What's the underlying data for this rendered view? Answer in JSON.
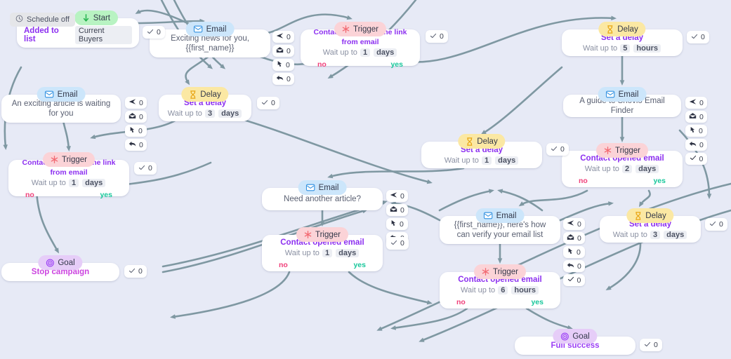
{
  "canvas": {
    "background": "#e7eaf6",
    "edge_color": "#7f98a2"
  },
  "schedule_chip": {
    "label": "Schedule off",
    "icon": "clock-icon"
  },
  "colors": {
    "email": "#cce6fb",
    "trigger": "#fbd3d7",
    "delay": "#fbe8a3",
    "goal": "#e6cdf8",
    "start": "#b8f3c2",
    "title_purple": "#8c2ff0",
    "title_magenta": "#cc44e0",
    "yes": "#18c79b",
    "no": "#f0407a"
  },
  "labels": {
    "wait_prefix": "Wait up to",
    "yes": "yes",
    "no": "no"
  },
  "stat_icons": [
    "sent-icon",
    "opened-icon",
    "clicked-icon",
    "replied-icon",
    "check-icon"
  ],
  "nodes": [
    {
      "id": "start",
      "type": "start",
      "pill": "Start",
      "pill_icon": "arrow-down-icon",
      "title": "Added to list",
      "value": "Current Buyers",
      "check": "0"
    },
    {
      "id": "email-1",
      "type": "email",
      "pill": "Email",
      "pill_icon": "envelope-icon",
      "body": "Exciting news for you, {{first_name}}",
      "stats": [
        "0",
        "0",
        "0",
        "0"
      ]
    },
    {
      "id": "trigger-1",
      "type": "trigger",
      "pill": "Trigger",
      "pill_icon": "star-icon",
      "title": "Contact clicked on the link from email",
      "wait_value": "1",
      "wait_unit": "days",
      "check": "0"
    },
    {
      "id": "delay-1",
      "type": "delay",
      "pill": "Delay",
      "pill_icon": "hourglass-icon",
      "title": "Set a delay",
      "wait_value": "5",
      "wait_unit": "hours",
      "check": "0"
    },
    {
      "id": "email-2",
      "type": "email",
      "pill": "Email",
      "pill_icon": "envelope-icon",
      "body": "An exciting article is waiting for you",
      "stats": [
        "0",
        "0",
        "0",
        "0"
      ]
    },
    {
      "id": "delay-2",
      "type": "delay",
      "pill": "Delay",
      "pill_icon": "hourglass-icon",
      "title": "Set a delay",
      "wait_value": "3",
      "wait_unit": "days",
      "check": "0"
    },
    {
      "id": "email-3",
      "type": "email",
      "pill": "Email",
      "pill_icon": "envelope-icon",
      "body": "A guide to Snovio Email Finder",
      "stats": [
        "0",
        "0",
        "0",
        "0",
        "0"
      ]
    },
    {
      "id": "trigger-2",
      "type": "trigger",
      "pill": "Trigger",
      "pill_icon": "star-icon",
      "title": "Contact clicked on the link from email",
      "wait_value": "1",
      "wait_unit": "days",
      "check": "0"
    },
    {
      "id": "delay-3",
      "type": "delay",
      "pill": "Delay",
      "pill_icon": "hourglass-icon",
      "title": "Set a delay",
      "wait_value": "1",
      "wait_unit": "days",
      "check": "0"
    },
    {
      "id": "trigger-3",
      "type": "trigger",
      "pill": "Trigger",
      "pill_icon": "star-icon",
      "title": "Contact opened email",
      "wait_value": "2",
      "wait_unit": "days"
    },
    {
      "id": "email-4",
      "type": "email",
      "pill": "Email",
      "pill_icon": "envelope-icon",
      "body": "Need another article?",
      "stats": [
        "0",
        "0",
        "0",
        "0"
      ]
    },
    {
      "id": "trigger-4",
      "type": "trigger",
      "pill": "Trigger",
      "pill_icon": "star-icon",
      "title": "Contact opened email",
      "wait_value": "1",
      "wait_unit": "days",
      "check": "0"
    },
    {
      "id": "email-5",
      "type": "email",
      "pill": "Email",
      "pill_icon": "envelope-icon",
      "body": "{{first_name}}, here's how can verify your email list",
      "stats": [
        "0",
        "0",
        "0",
        "0",
        "0"
      ]
    },
    {
      "id": "trigger-5",
      "type": "trigger",
      "pill": "Trigger",
      "pill_icon": "star-icon",
      "title": "Contact opened email",
      "wait_value": "6",
      "wait_unit": "hours"
    },
    {
      "id": "delay-4",
      "type": "delay",
      "pill": "Delay",
      "pill_icon": "hourglass-icon",
      "title": "Set a delay",
      "wait_value": "3",
      "wait_unit": "days",
      "check": "0"
    },
    {
      "id": "goal-1",
      "type": "goal",
      "pill": "Goal",
      "pill_icon": "target-icon",
      "title": "Stop campaign",
      "check": "0"
    },
    {
      "id": "goal-2",
      "type": "goal",
      "pill": "Goal",
      "pill_icon": "target-icon",
      "title": "Full success",
      "check": "0"
    }
  ]
}
